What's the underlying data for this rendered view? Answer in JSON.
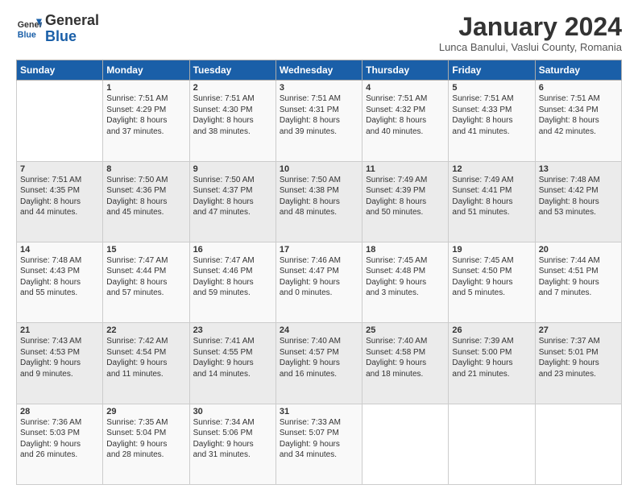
{
  "header": {
    "logo_general": "General",
    "logo_blue": "Blue",
    "month_title": "January 2024",
    "location": "Lunca Banului, Vaslui County, Romania"
  },
  "weekdays": [
    "Sunday",
    "Monday",
    "Tuesday",
    "Wednesday",
    "Thursday",
    "Friday",
    "Saturday"
  ],
  "weeks": [
    [
      {
        "day": null
      },
      {
        "day": "1",
        "sunrise": "7:51 AM",
        "sunset": "4:29 PM",
        "daylight": "8 hours and 37 minutes."
      },
      {
        "day": "2",
        "sunrise": "7:51 AM",
        "sunset": "4:30 PM",
        "daylight": "8 hours and 38 minutes."
      },
      {
        "day": "3",
        "sunrise": "7:51 AM",
        "sunset": "4:31 PM",
        "daylight": "8 hours and 39 minutes."
      },
      {
        "day": "4",
        "sunrise": "7:51 AM",
        "sunset": "4:32 PM",
        "daylight": "8 hours and 40 minutes."
      },
      {
        "day": "5",
        "sunrise": "7:51 AM",
        "sunset": "4:33 PM",
        "daylight": "8 hours and 41 minutes."
      },
      {
        "day": "6",
        "sunrise": "7:51 AM",
        "sunset": "4:34 PM",
        "daylight": "8 hours and 42 minutes."
      }
    ],
    [
      {
        "day": "7",
        "sunrise": "7:51 AM",
        "sunset": "4:35 PM",
        "daylight": "8 hours and 44 minutes."
      },
      {
        "day": "8",
        "sunrise": "7:50 AM",
        "sunset": "4:36 PM",
        "daylight": "8 hours and 45 minutes."
      },
      {
        "day": "9",
        "sunrise": "7:50 AM",
        "sunset": "4:37 PM",
        "daylight": "8 hours and 47 minutes."
      },
      {
        "day": "10",
        "sunrise": "7:50 AM",
        "sunset": "4:38 PM",
        "daylight": "8 hours and 48 minutes."
      },
      {
        "day": "11",
        "sunrise": "7:49 AM",
        "sunset": "4:39 PM",
        "daylight": "8 hours and 50 minutes."
      },
      {
        "day": "12",
        "sunrise": "7:49 AM",
        "sunset": "4:41 PM",
        "daylight": "8 hours and 51 minutes."
      },
      {
        "day": "13",
        "sunrise": "7:48 AM",
        "sunset": "4:42 PM",
        "daylight": "8 hours and 53 minutes."
      }
    ],
    [
      {
        "day": "14",
        "sunrise": "7:48 AM",
        "sunset": "4:43 PM",
        "daylight": "8 hours and 55 minutes."
      },
      {
        "day": "15",
        "sunrise": "7:47 AM",
        "sunset": "4:44 PM",
        "daylight": "8 hours and 57 minutes."
      },
      {
        "day": "16",
        "sunrise": "7:47 AM",
        "sunset": "4:46 PM",
        "daylight": "8 hours and 59 minutes."
      },
      {
        "day": "17",
        "sunrise": "7:46 AM",
        "sunset": "4:47 PM",
        "daylight": "9 hours and 0 minutes."
      },
      {
        "day": "18",
        "sunrise": "7:45 AM",
        "sunset": "4:48 PM",
        "daylight": "9 hours and 3 minutes."
      },
      {
        "day": "19",
        "sunrise": "7:45 AM",
        "sunset": "4:50 PM",
        "daylight": "9 hours and 5 minutes."
      },
      {
        "day": "20",
        "sunrise": "7:44 AM",
        "sunset": "4:51 PM",
        "daylight": "9 hours and 7 minutes."
      }
    ],
    [
      {
        "day": "21",
        "sunrise": "7:43 AM",
        "sunset": "4:53 PM",
        "daylight": "9 hours and 9 minutes."
      },
      {
        "day": "22",
        "sunrise": "7:42 AM",
        "sunset": "4:54 PM",
        "daylight": "9 hours and 11 minutes."
      },
      {
        "day": "23",
        "sunrise": "7:41 AM",
        "sunset": "4:55 PM",
        "daylight": "9 hours and 14 minutes."
      },
      {
        "day": "24",
        "sunrise": "7:40 AM",
        "sunset": "4:57 PM",
        "daylight": "9 hours and 16 minutes."
      },
      {
        "day": "25",
        "sunrise": "7:40 AM",
        "sunset": "4:58 PM",
        "daylight": "9 hours and 18 minutes."
      },
      {
        "day": "26",
        "sunrise": "7:39 AM",
        "sunset": "5:00 PM",
        "daylight": "9 hours and 21 minutes."
      },
      {
        "day": "27",
        "sunrise": "7:37 AM",
        "sunset": "5:01 PM",
        "daylight": "9 hours and 23 minutes."
      }
    ],
    [
      {
        "day": "28",
        "sunrise": "7:36 AM",
        "sunset": "5:03 PM",
        "daylight": "9 hours and 26 minutes."
      },
      {
        "day": "29",
        "sunrise": "7:35 AM",
        "sunset": "5:04 PM",
        "daylight": "9 hours and 28 minutes."
      },
      {
        "day": "30",
        "sunrise": "7:34 AM",
        "sunset": "5:06 PM",
        "daylight": "9 hours and 31 minutes."
      },
      {
        "day": "31",
        "sunrise": "7:33 AM",
        "sunset": "5:07 PM",
        "daylight": "9 hours and 34 minutes."
      },
      {
        "day": null
      },
      {
        "day": null
      },
      {
        "day": null
      }
    ]
  ],
  "labels": {
    "sunrise_prefix": "Sunrise: ",
    "sunset_prefix": "Sunset: ",
    "daylight_prefix": "Daylight: "
  }
}
